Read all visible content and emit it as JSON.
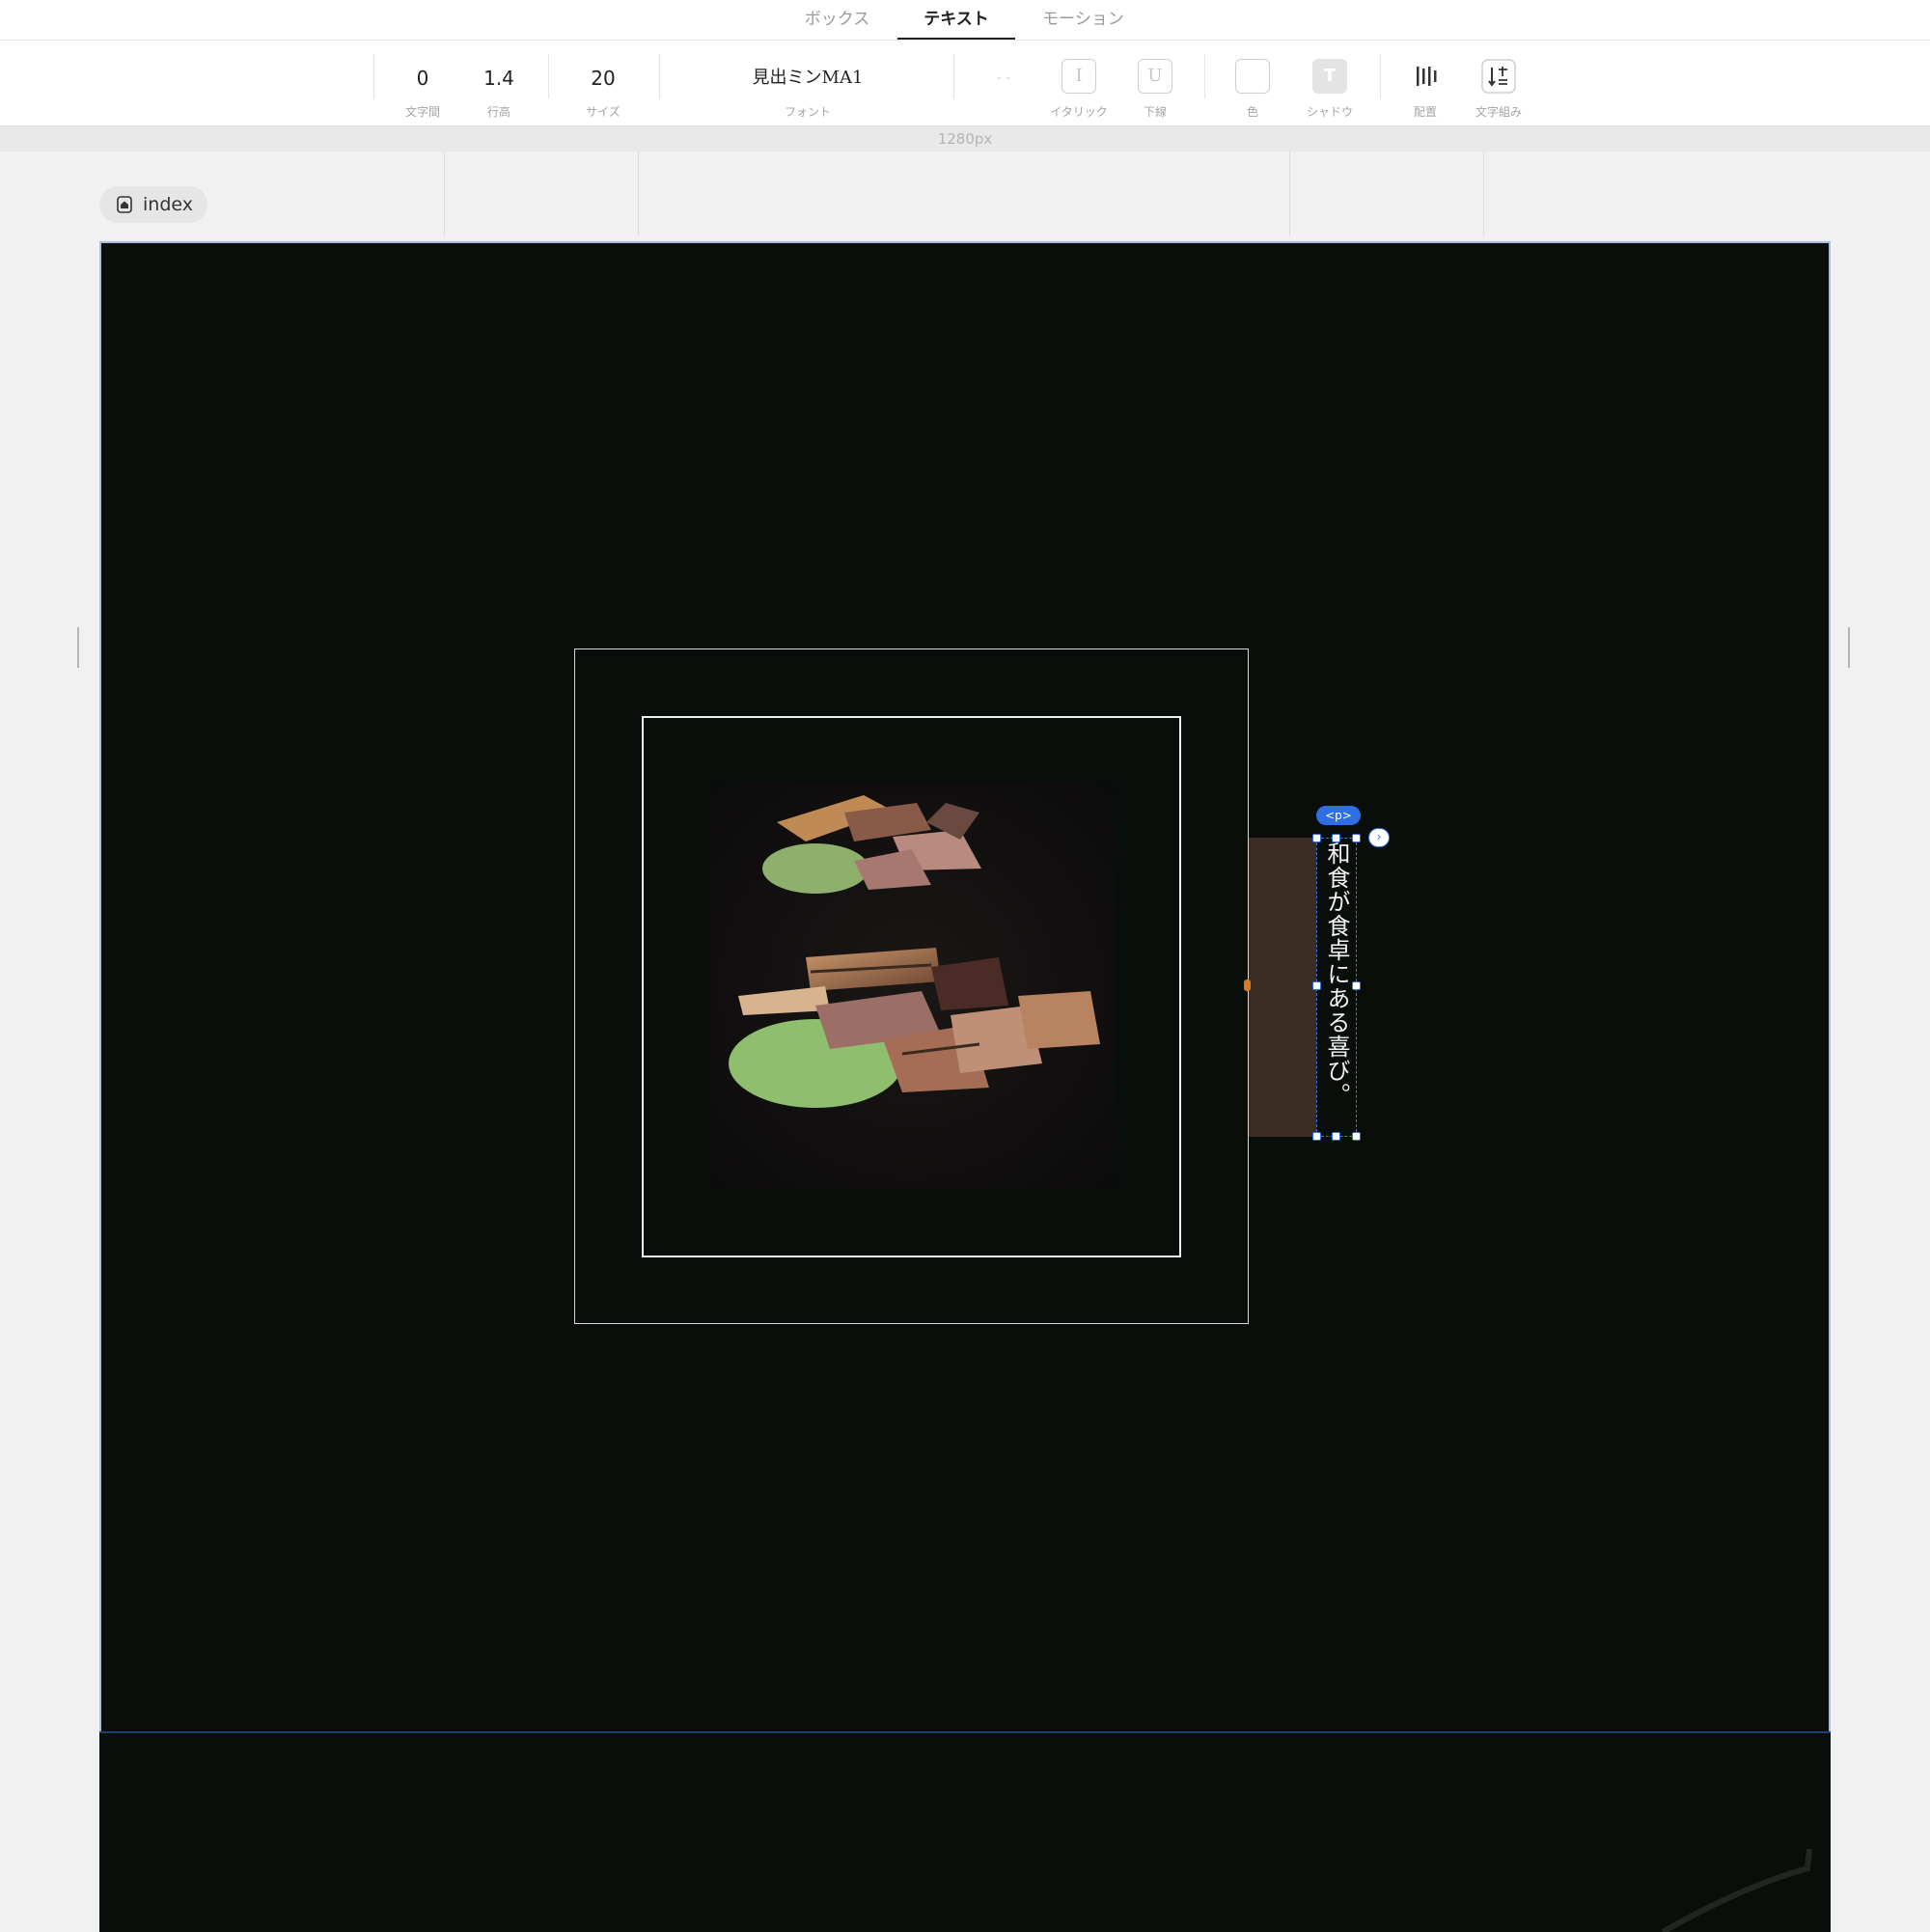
{
  "tabs": [
    {
      "label": "ボックス"
    },
    {
      "label": "テキスト"
    },
    {
      "label": "モーション"
    }
  ],
  "active_tab": "テキスト",
  "toolbar": {
    "letter_spacing": {
      "value": "0",
      "label": "文字間"
    },
    "line_height": {
      "value": "1.4",
      "label": "行高"
    },
    "size": {
      "value": "20",
      "label": "サイズ"
    },
    "font": {
      "value": "見出ミンMA1",
      "label": "フォント"
    },
    "dash": {
      "value": "- -"
    },
    "italic": {
      "glyph": "I",
      "label": "イタリック"
    },
    "underline": {
      "glyph": "U",
      "label": "下線"
    },
    "color": {
      "label": "色",
      "value": "#ffffff"
    },
    "shadow": {
      "glyph": "T",
      "label": "シャドウ"
    },
    "align": {
      "label": "配置",
      "icon": "vertical-align-icon"
    },
    "writing": {
      "label": "文字組み",
      "icon": "vertical-writing-icon"
    }
  },
  "ruler": {
    "width_text": "1280px"
  },
  "page": {
    "name": "index",
    "icon": "home-icon"
  },
  "canvas": {
    "selected_tag": "<p>",
    "vertical_text": "和食が食卓にある喜び。",
    "image": "grilled-meat-photo",
    "background_color": "#0a0e0a",
    "accent_color": "#3b2d22"
  }
}
